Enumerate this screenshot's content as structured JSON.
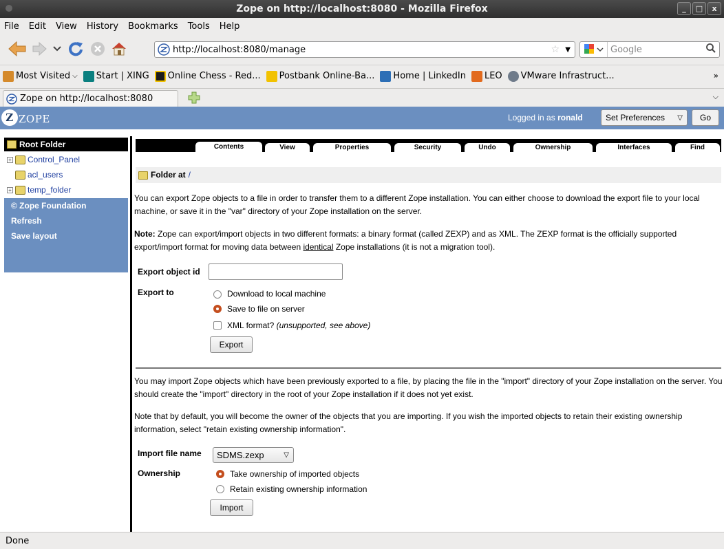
{
  "window": {
    "title": "Zope on http://localhost:8080 - Mozilla Firefox",
    "controls": {
      "minimize": "_",
      "maximize": "□",
      "close": "x"
    }
  },
  "menu": [
    "File",
    "Edit",
    "View",
    "History",
    "Bookmarks",
    "Tools",
    "Help"
  ],
  "nav": {
    "url": "http://localhost:8080/manage",
    "search_placeholder": "Google"
  },
  "bookmarks": [
    {
      "label": "Most Visited",
      "icon": "folder-icon",
      "color": "#d58a2b"
    },
    {
      "label": "Start | XING",
      "icon": "xing-icon",
      "color": "#0a7f7f"
    },
    {
      "label": "Online Chess - Red...",
      "icon": "chess-icon",
      "color": "#1b1b1b"
    },
    {
      "label": "Postbank Online-Ba...",
      "icon": "postbank-icon",
      "color": "#f2c200"
    },
    {
      "label": "Home | LinkedIn",
      "icon": "linkedin-icon",
      "color": "#2d6fb6"
    },
    {
      "label": "LEO",
      "icon": "leo-icon",
      "color": "#e26a1e"
    },
    {
      "label": "VMware Infrastruct...",
      "icon": "vmware-icon",
      "color": "#6f7b8a"
    }
  ],
  "tab": {
    "title": "Zope on http://localhost:8080"
  },
  "zope": {
    "logo_text": "ZOPE",
    "logged_in_prefix": "Logged in as",
    "user": "ronald",
    "preferences": "Set Preferences",
    "go": "Go"
  },
  "tree": {
    "root": "Root Folder",
    "nodes": [
      {
        "label": "Control_Panel",
        "expandable": true
      },
      {
        "label": "acl_users",
        "expandable": false
      },
      {
        "label": "temp_folder",
        "expandable": true
      }
    ],
    "actions": [
      "© Zope Foundation",
      "Refresh",
      "Save layout"
    ]
  },
  "tabs": [
    "Contents",
    "View",
    "Properties",
    "Security",
    "Undo",
    "Ownership",
    "Interfaces",
    "Find"
  ],
  "folder": {
    "label": "Folder at",
    "path": "/"
  },
  "export": {
    "intro": "You can export Zope objects to a file in order to transfer them to a different Zope installation. You can either choose to download the export file to your local machine, or save it in the \"var\" directory of your Zope installation on the server.",
    "note_label": "Note:",
    "note_before": "Zope can export/import objects in two different formats: a binary format (called ZEXP) and as XML. The ZEXP format is the officially supported export/import format for moving data between",
    "note_link": "identical",
    "note_after": "Zope installations (it is not a migration tool).",
    "object_id_label": "Export object id",
    "object_id_value": "",
    "export_to_label": "Export to",
    "options": [
      "Download to local machine",
      "Save to file on server"
    ],
    "selected": 1,
    "xml_label": "XML format?",
    "xml_note": "(unsupported, see above)",
    "button": "Export"
  },
  "import": {
    "intro": "You may import Zope objects which have been previously exported to a file, by placing the file in the \"import\" directory of your Zope installation on the server. You should create the \"import\" directory in the root of your Zope installation if it does not yet exist.",
    "note": "Note that by default, you will become the owner of the objects that you are importing. If you wish the imported objects to retain their existing ownership information, select \"retain existing ownership information\".",
    "file_label": "Import file name",
    "file_value": "SDMS.zexp",
    "ownership_label": "Ownership",
    "options": [
      "Take ownership of imported objects",
      "Retain existing ownership information"
    ],
    "selected": 0,
    "button": "Import"
  },
  "status": "Done"
}
